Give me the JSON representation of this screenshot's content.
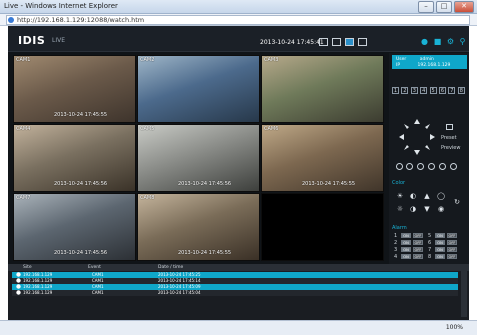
{
  "window": {
    "title": "Live - Windows Internet Explorer",
    "url": "http://192.168.1.129:12088/watch.htm",
    "minimize": "–",
    "maximize": "□",
    "close": "✕"
  },
  "app": {
    "logo": "IDIS",
    "mode": "LIVE",
    "clock": "2013-10-24 17:45:41"
  },
  "cameras": [
    {
      "label": "CAM1",
      "timestamp": "2013-10-24 17:45:55",
      "colors": [
        "#6b5a4a",
        "#a08a70",
        "#3e342c"
      ]
    },
    {
      "label": "CAM2",
      "timestamp": "",
      "colors": [
        "#4c6a8c",
        "#9fb6c8",
        "#27384a"
      ]
    },
    {
      "label": "CAM3",
      "timestamp": "",
      "colors": [
        "#6f7a5a",
        "#b7a98b",
        "#3c3c30"
      ]
    },
    {
      "label": "CAM4",
      "timestamp": "2013-10-24 17:45:56",
      "colors": [
        "#7a7060",
        "#c2b29c",
        "#3a3228"
      ]
    },
    {
      "label": "CAM5",
      "timestamp": "2013-10-24 17:45:56",
      "colors": [
        "#8a8c88",
        "#c9cbc6",
        "#3d3f3c"
      ]
    },
    {
      "label": "CAM6",
      "timestamp": "2013-10-24 17:45:55",
      "colors": [
        "#7d6850",
        "#bfa988",
        "#40352a"
      ]
    },
    {
      "label": "CAM7",
      "timestamp": "2013-10-24 17:45:56",
      "colors": [
        "#5c6670",
        "#aab3ba",
        "#2c3035"
      ]
    },
    {
      "label": "CAM8",
      "timestamp": "2013-10-24 17:45:55",
      "colors": [
        "#7a6c58",
        "#c4b49c",
        "#3a3026"
      ]
    },
    {
      "label": "",
      "timestamp": "",
      "colors": [
        "#000000",
        "#000000",
        "#000000"
      ]
    }
  ],
  "panel": {
    "user_label": "User",
    "user_value": "admin",
    "ip_label": "IP",
    "ip_value": "192.168.1.129",
    "numbers": [
      "1",
      "2",
      "3",
      "4",
      "5",
      "6",
      "7",
      "8"
    ],
    "preset": "Preset",
    "preview": "Preview",
    "color_label": "Color",
    "alarm_label": "Alarm",
    "alarm_rows": [
      {
        "left": "1",
        "right": "5"
      },
      {
        "left": "2",
        "right": "6"
      },
      {
        "left": "3",
        "right": "7"
      },
      {
        "left": "4",
        "right": "8"
      }
    ],
    "on": "ON",
    "off": "OFF"
  },
  "log": {
    "headers": {
      "site": "Site",
      "event": "Event",
      "datetime": "Date / time"
    },
    "rows": [
      {
        "site": "192.168.1.129",
        "event": "CAM1",
        "datetime": "2013-10-24 17:45:25",
        "style": "hl"
      },
      {
        "site": "192.168.1.129",
        "event": "CAM1",
        "datetime": "2013-10-24 17:45:14",
        "style": "dk"
      },
      {
        "site": "192.168.1.129",
        "event": "CAM1",
        "datetime": "2013-10-24 17:45:09",
        "style": "hl"
      },
      {
        "site": "192.168.1.129",
        "event": "CAM1",
        "datetime": "2013-10-24 17:45:04",
        "style": "dk"
      }
    ]
  },
  "status": {
    "zoom": "100%"
  }
}
